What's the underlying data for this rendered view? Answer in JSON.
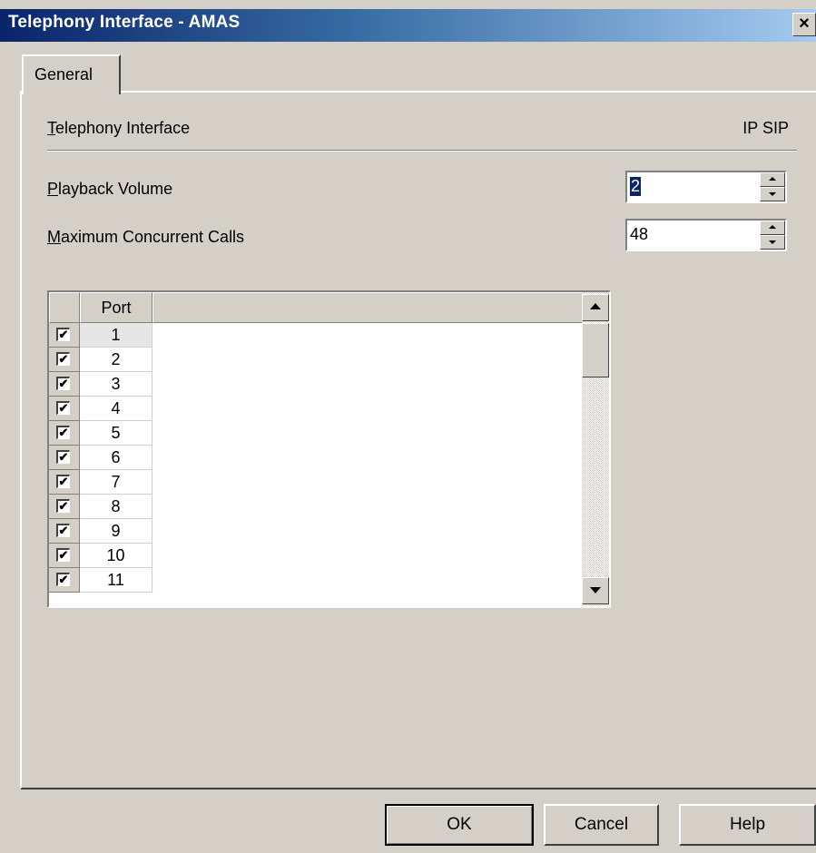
{
  "window": {
    "title": "Telephony Interface - AMAS",
    "close_glyph": "✕"
  },
  "tabs": [
    {
      "label": "General"
    }
  ],
  "general": {
    "telephony_interface_label": "Telephony Interface",
    "telephony_interface_value": "IP SIP",
    "playback_volume_label": "Playback Volume",
    "playback_volume_value": "2",
    "max_calls_label": "Maximum Concurrent Calls",
    "max_calls_value": "48"
  },
  "port_table": {
    "columns": [
      "",
      "Port",
      ""
    ],
    "check_glyph": "✔",
    "rows": [
      {
        "port": "1",
        "checked": true
      },
      {
        "port": "2",
        "checked": true
      },
      {
        "port": "3",
        "checked": true
      },
      {
        "port": "4",
        "checked": true
      },
      {
        "port": "5",
        "checked": true
      },
      {
        "port": "6",
        "checked": true
      },
      {
        "port": "7",
        "checked": true
      },
      {
        "port": "8",
        "checked": true
      },
      {
        "port": "9",
        "checked": true
      },
      {
        "port": "10",
        "checked": true
      },
      {
        "port": "11",
        "checked": true
      }
    ]
  },
  "buttons": {
    "ok": "OK",
    "cancel": "Cancel",
    "help": "Help"
  }
}
